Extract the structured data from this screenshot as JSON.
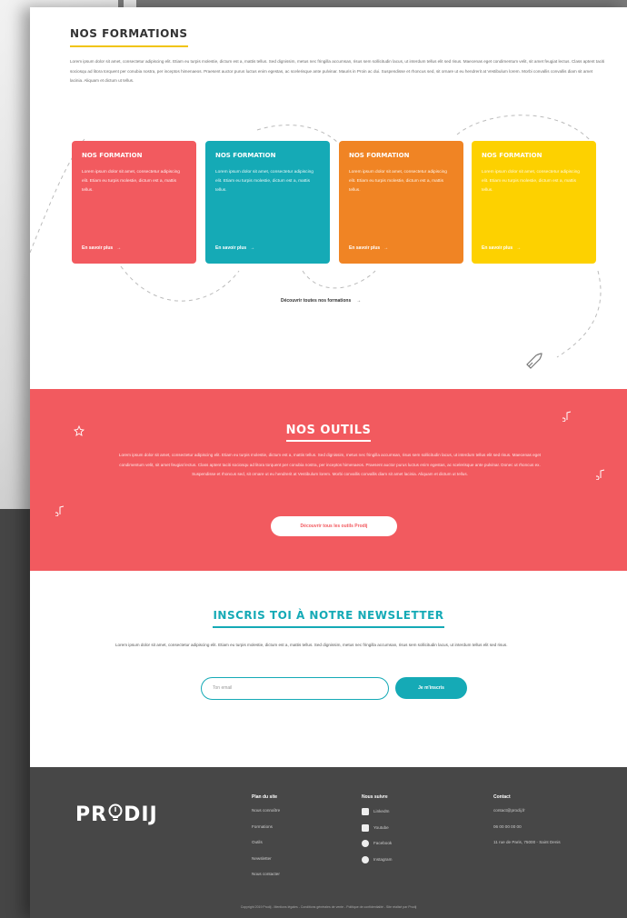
{
  "formations": {
    "title": "NOS FORMATIONS",
    "description": "Lorem ipsum dolor sit amet, consectetur adipiscing elit. Etiam eu turpis molestie, dictum est a, mattis tellus. Sed dignissim, metus nec fringilla accumsan, risus sem sollicitudin lacus, ut interdum tellus elit sed risus. Maecenas eget condimentum velit, sit amet feugiat lectus. Class aptent taciti sociosqu ad litora torquent per conubia nostra, per inceptos himenaeos. Praesent auctor purus luctus enim egestas, ac scelerisque ante pulvinar. Mauris in Proin ac dui. Suspendisse et rhoncus sed, sit ornare ut eu hendrerit at Vestibulum lorem. Morbi convallis convallis diam sit amet lacinia. Aliquam et dictum ut tellus.",
    "cards": [
      {
        "title": "NOS FORMATION",
        "text": "Lorem ipsum dolor sit amet, consectetur adipiscing elit. Etiam eu turpis molestie, dictum est a, mattis tellus.",
        "link": "En savoir plus"
      },
      {
        "title": "NOS FORMATION",
        "text": "Lorem ipsum dolor sit amet, consectetur adipiscing elit. Etiam eu turpis molestie, dictum est a, mattis tellus.",
        "link": "En savoir plus"
      },
      {
        "title": "NOS FORMATION",
        "text": "Lorem ipsum dolor sit amet, consectetur adipiscing elit. Etiam eu turpis molestie, dictum est a, mattis tellus.",
        "link": "En savoir plus"
      },
      {
        "title": "NOS FORMATION",
        "text": "Lorem ipsum dolor sit amet, consectetur adipiscing elit. Etiam eu turpis molestie, dictum est a, mattis tellus.",
        "link": "En savoir plus"
      }
    ],
    "all_link": "Découvrir toutes nos formations",
    "arrow": "→"
  },
  "outils": {
    "title": "NOS OUTILS",
    "text": "Lorem ipsum dolor sit amet, consectetur adipiscing elit. Etiam eu turpis molestie, dictum est a, mattis tellus. Sed dignissim, metus nec fringilla accumsan, risus sem sollicitudin lacus, ut interdum tellus elit sed risus. Maecenas eget condimentum velit, sit amet feugiat lectus. Class aptent taciti sociosqu ad litora torquent per conubia nostra, per inceptos himenaeos. Praesent auctor purus luctus enim egestas, ac scelerisque ante pulvinar. Donec ut rhoncus ex. Suspendisse et rhoncus sed, sit ornare ut eu hendrerit at Vestibulum lorem. Morbi convallis convallis diam sit amet lacinia. Aliquam et dictum ut tellus.",
    "button": "Découvrir tous les outils Prodij"
  },
  "newsletter": {
    "title": "INSCRIS TOI À NOTRE NEWSLETTER",
    "text": "Lorem ipsum dolor sit amet, consectetur adipiscing elit. Etiam eu turpis molestie, dictum est a, mattis tellus. Sed dignissim, metus nec fringilla accumsan, risus sem sollicitudin lacus, ut interdum tellus elit sed risus.",
    "placeholder": "Ton email",
    "button": "Je m'inscris"
  },
  "footer": {
    "logo_left": "PR",
    "logo_right": "DIJ",
    "plan": {
      "heading": "Plan du site",
      "items": [
        "Nous connaître",
        "Formations",
        "Outils",
        "Newsletter",
        "Nous contacter"
      ]
    },
    "social": {
      "heading": "Nous suivre",
      "items": [
        "LinkedIn",
        "Youtube",
        "Facebook",
        "Instagram"
      ]
    },
    "contact": {
      "heading": "Contact",
      "items": [
        "contact@prodij.fr",
        "06 00 00 00 00",
        "11 rue de Paris, 75000 - Saint Denis"
      ]
    },
    "copyright": "Copyright 2019 Prodij - Mentions légales - Conditions générales de vente - Politique de confidentialité - Site réalisé par Prodij"
  },
  "colors": {
    "red": "#f25a5f",
    "teal": "#15aab6",
    "orange": "#f08424",
    "yellow": "#fdd100",
    "footer": "#474747"
  }
}
